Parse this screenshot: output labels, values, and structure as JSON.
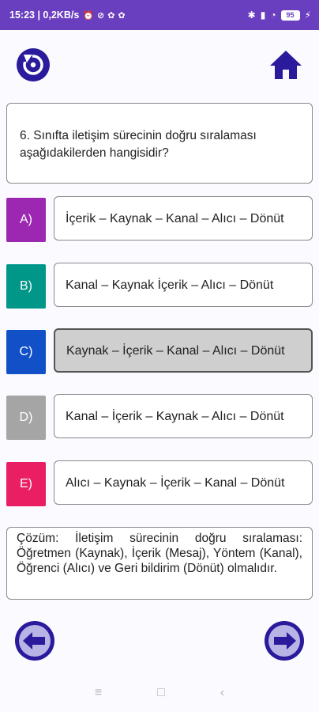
{
  "status_bar": {
    "time_info": "15:23 | 0,2KB/s",
    "battery": "95"
  },
  "question": {
    "text": "6. Sınıfta iletişim sürecinin doğru sıralaması aşağıdakilerden hangisidir?"
  },
  "options": [
    {
      "letter": "A)",
      "text": "İçerik – Kaynak – Kanal – Alıcı – Dönüt",
      "color": "#9c27b0",
      "selected": false
    },
    {
      "letter": "B)",
      "text": "Kanal – Kaynak İçerik – Alıcı – Dönüt",
      "color": "#009688",
      "selected": false
    },
    {
      "letter": "C)",
      "text": "Kaynak – İçerik – Kanal – Alıcı – Dönüt",
      "color": "#1250c8",
      "selected": true
    },
    {
      "letter": "D)",
      "text": "Kanal – İçerik – Kaynak – Alıcı – Dönüt",
      "color": "#a5a5a5",
      "selected": false
    },
    {
      "letter": "E)",
      "text": "Alıcı – Kaynak – İçerik – Kanal – Dönüt",
      "color": "#e91e63",
      "selected": false
    }
  ],
  "solution": {
    "text": "Çözüm: İletişim sürecinin doğru sıralaması: Öğretmen (Kaynak), İçerik (Mesaj), Yöntem (Kanal), Öğrenci (Alıcı) ve Geri bildirim (Dönüt) olmalıdır."
  },
  "icons": {
    "restart": "restart-icon",
    "home": "home-icon",
    "prev": "arrow-left-icon",
    "next": "arrow-right-icon"
  },
  "colors": {
    "status_bar": "#6a3fbf",
    "icon_primary": "#2a1a9c"
  }
}
